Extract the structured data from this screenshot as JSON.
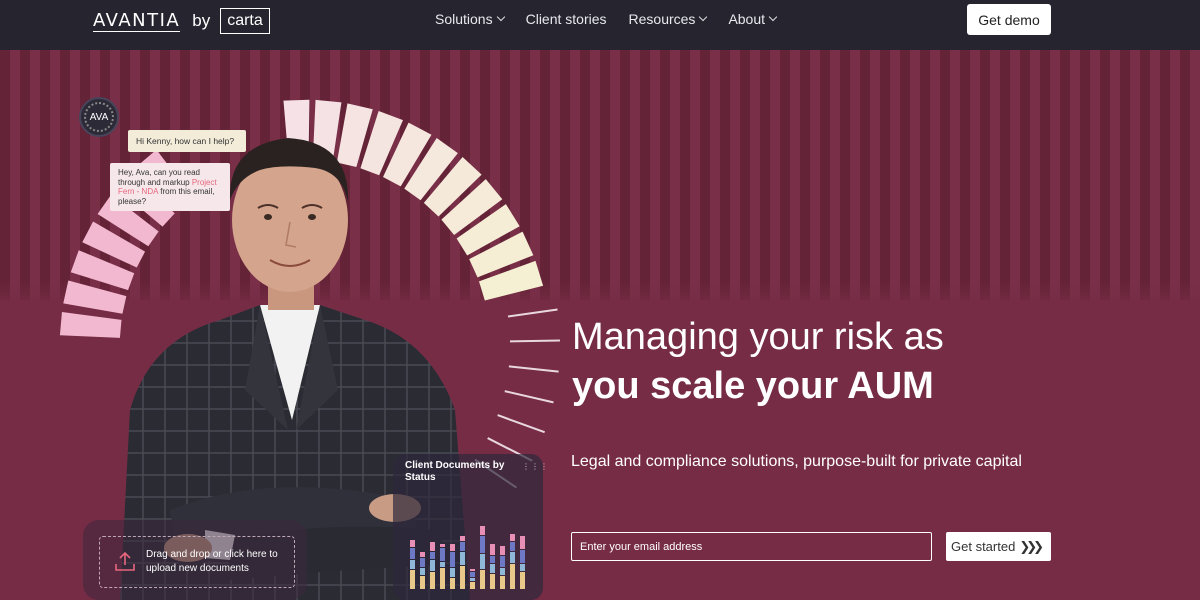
{
  "brand": {
    "name": "AVANTIA",
    "by": "by",
    "partner": "carta"
  },
  "nav": {
    "items": [
      {
        "label": "Solutions",
        "dropdown": true
      },
      {
        "label": "Client stories",
        "dropdown": false
      },
      {
        "label": "Resources",
        "dropdown": true
      },
      {
        "label": "About",
        "dropdown": true
      }
    ],
    "cta": "Get demo"
  },
  "hero": {
    "headline_line1": "Managing your risk as",
    "headline_line2": "you scale your AUM",
    "subheadline": "Legal and compliance solutions, purpose-built for private capital",
    "email_placeholder": "Enter your email address",
    "cta": "Get started",
    "cta_icon": "chevrons-right-icon"
  },
  "chat": {
    "avatar_label": "AVA",
    "bubble1": "Hi Kenny, how can I help?",
    "bubble2_pre": "Hey, Ava, can you read through and markup ",
    "bubble2_link": "Project Fern - NDA",
    "bubble2_post": " from this email, please?"
  },
  "upload": {
    "text": "Drag and drop or click here to upload new documents",
    "icon": "upload-icon"
  },
  "docs_card": {
    "title": "Client Documents by Status"
  },
  "colors": {
    "nav_bg": "#25242f",
    "hero_bg": "#762c45",
    "stripe_dark": "#652337",
    "accent_pink": "#e8657e"
  }
}
